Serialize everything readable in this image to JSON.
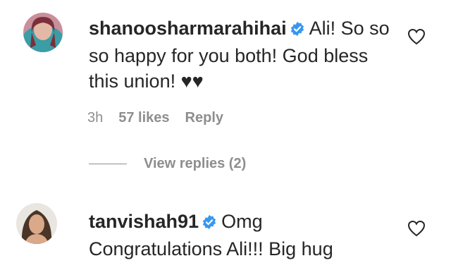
{
  "comments": [
    {
      "username": "shanoosharmarahihai",
      "verified": true,
      "text_lines": [
        "Ali! So so",
        "so happy for you both! God bless",
        "this union! ♥♥"
      ],
      "time": "3h",
      "likes": "57 likes",
      "reply": "Reply",
      "view_replies": "View replies (2)",
      "icons": {
        "like": "heart-outline-icon",
        "verified": "verified-badge-icon"
      }
    },
    {
      "username": "tanvishah91",
      "verified": true,
      "text_lines": [
        "Omg",
        "Congratulations Ali!!! Big hug"
      ],
      "icons": {
        "like": "heart-outline-icon",
        "verified": "verified-badge-icon"
      }
    }
  ],
  "colors": {
    "verified": "#3897f0",
    "text": "#262626",
    "secondary": "#8e8e8e"
  }
}
